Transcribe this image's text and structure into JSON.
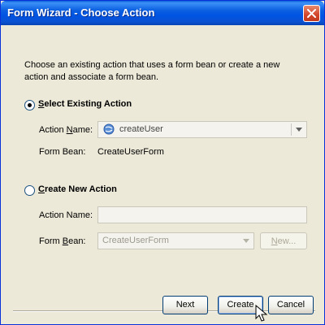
{
  "window": {
    "title": "Form Wizard - Choose Action"
  },
  "intro": "Choose an existing action that uses a form bean or create a new action and associate a form bean.",
  "existing": {
    "radio_label_mnemonic": "S",
    "radio_label_rest": "elect Existing Action",
    "selected": true,
    "action_name_label_pre": "Action ",
    "action_name_label_mnemonic": "N",
    "action_name_label_post": "ame:",
    "action_name_value": "createUser",
    "form_bean_label": "Form Bean:",
    "form_bean_value": "CreateUserForm"
  },
  "new_action": {
    "radio_label_mnemonic": "C",
    "radio_label_rest": "reate New Action",
    "selected": false,
    "action_name_label": "Action Name:",
    "action_name_value": "",
    "form_bean_label_pre": "Form ",
    "form_bean_label_mnemonic": "B",
    "form_bean_label_post": "ean:",
    "form_bean_value": "CreateUserForm",
    "new_button_mnemonic": "N",
    "new_button_rest": "ew..."
  },
  "buttons": {
    "next": "Next",
    "create": "Create",
    "cancel": "Cancel"
  },
  "colors": {
    "titlebar": "#0054e3",
    "dialog_bg": "#ece9d8",
    "close_button": "#d2452a"
  }
}
